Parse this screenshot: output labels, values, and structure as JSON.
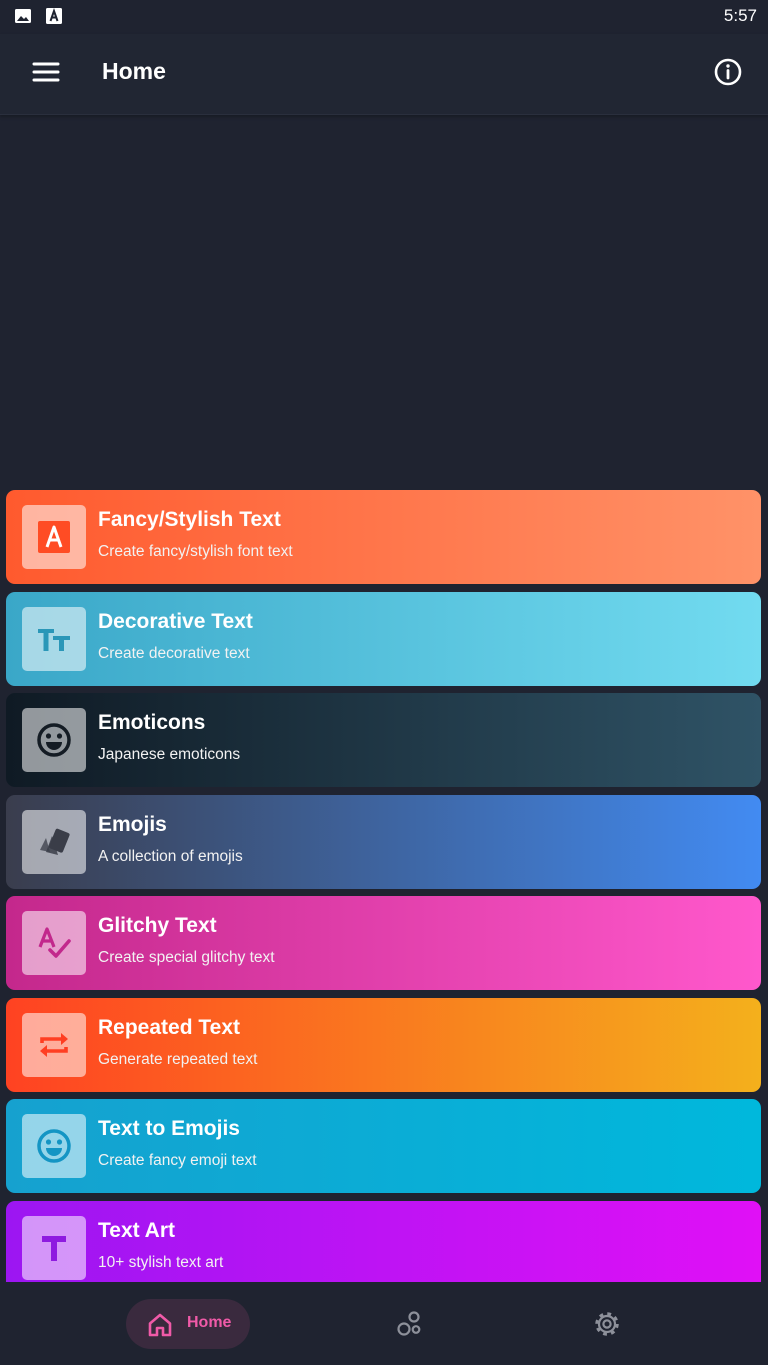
{
  "status_bar": {
    "time": "5:57",
    "icons": [
      "image-icon",
      "text-a-icon"
    ]
  },
  "app_bar": {
    "title": "Home",
    "menu_icon": "hamburger-menu-icon",
    "info_icon": "info-circle-icon"
  },
  "cards": [
    {
      "title": "Fancy/Stylish Text",
      "subtitle": "Create fancy/stylish font text",
      "icon": "letter-a-icon",
      "colors": [
        "#ff5a2e",
        "#ff9268"
      ],
      "icon_color": "#ff4c24"
    },
    {
      "title": "Decorative Text",
      "subtitle": "Create decorative text",
      "icon": "text-size-icon",
      "colors": [
        "#3aa7c8",
        "#72dbf0"
      ],
      "icon_color": "#2a97b8"
    },
    {
      "title": "Emoticons",
      "subtitle": "Japanese emoticons",
      "icon": "smiley-icon",
      "colors": [
        "#0f1a24",
        "#2f5366"
      ],
      "icon_color": "#141c24"
    },
    {
      "title": "Emojis",
      "subtitle": "A collection of emojis",
      "icon": "cards-icon",
      "colors": [
        "#3a3d4d",
        "#428bf2"
      ],
      "icon_color": "#3a3d48"
    },
    {
      "title": "Glitchy Text",
      "subtitle": "Create special glitchy text",
      "icon": "spell-check-icon",
      "colors": [
        "#c4288c",
        "#ff58cc"
      ],
      "icon_color": "#c2288c"
    },
    {
      "title": "Repeated Text",
      "subtitle": "Generate repeated text",
      "icon": "repeat-icon",
      "colors": [
        "#ff4222",
        "#f4b01c"
      ],
      "icon_color": "#ff3e22"
    },
    {
      "title": "Text to Emojis",
      "subtitle": "Create fancy emoji text",
      "icon": "smiley-icon",
      "colors": [
        "#16a1cf",
        "#00b8dc"
      ],
      "icon_color": "#1495c4"
    },
    {
      "title": "Text Art",
      "subtitle": "10+ stylish text art",
      "icon": "letter-t-icon",
      "colors": [
        "#9c16f2",
        "#e010f6"
      ],
      "icon_color": "#8e1ae0"
    }
  ],
  "bottom_nav": {
    "items": [
      {
        "label": "Home",
        "icon": "home-icon",
        "active": true
      },
      {
        "label": "",
        "icon": "bubbles-icon",
        "active": false
      },
      {
        "label": "",
        "icon": "gear-icon",
        "active": false
      }
    ],
    "active_color": "#f05aa8"
  }
}
